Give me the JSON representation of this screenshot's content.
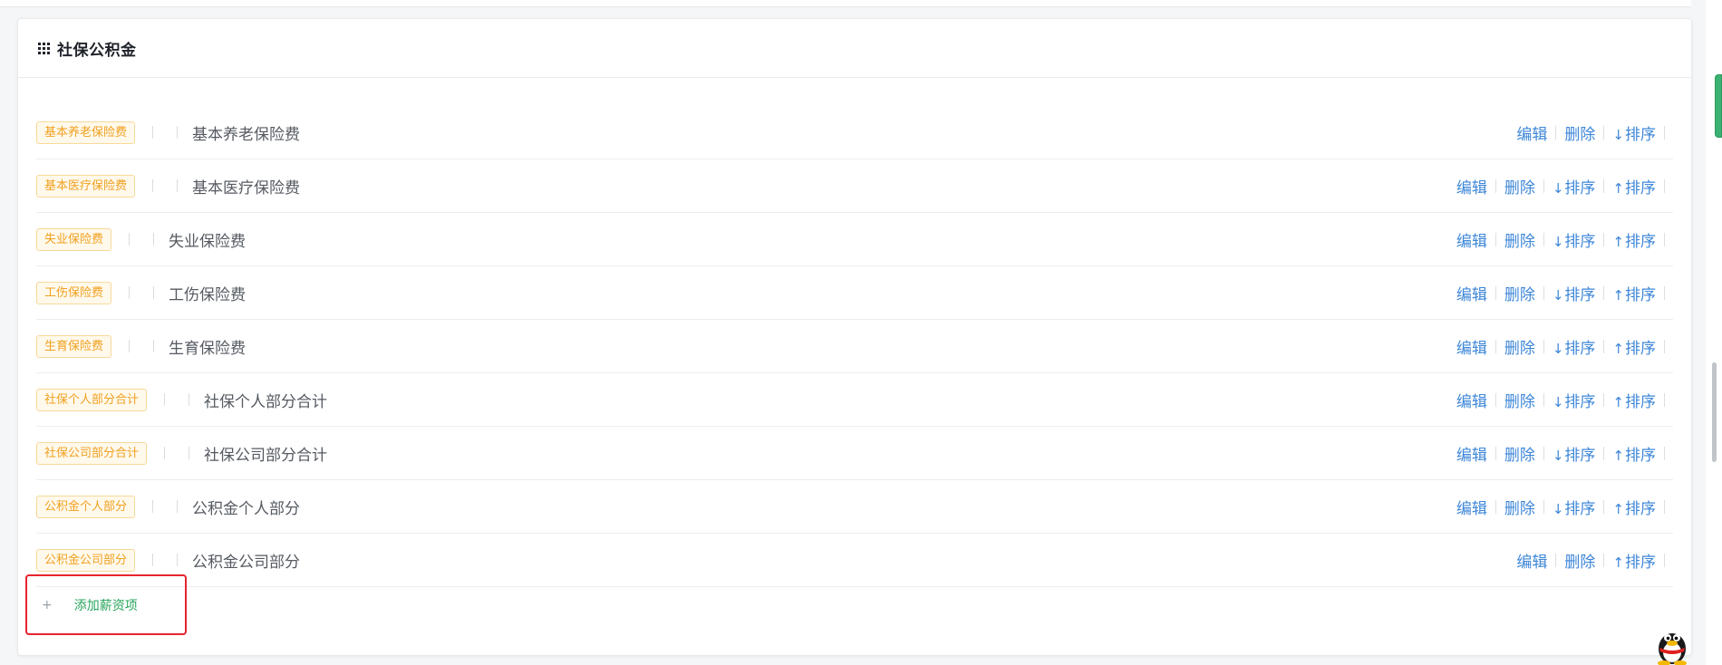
{
  "section": {
    "title": "社保公积金"
  },
  "rows": [
    {
      "tag": "基本养老保险费",
      "name": "基本养老保险费",
      "actions": {
        "edit": "编辑",
        "delete": "删除",
        "sort_down": "排序",
        "sort_up": null
      }
    },
    {
      "tag": "基本医疗保险费",
      "name": "基本医疗保险费",
      "actions": {
        "edit": "编辑",
        "delete": "删除",
        "sort_down": "排序",
        "sort_up": "排序"
      }
    },
    {
      "tag": "失业保险费",
      "name": "失业保险费",
      "actions": {
        "edit": "编辑",
        "delete": "删除",
        "sort_down": "排序",
        "sort_up": "排序"
      }
    },
    {
      "tag": "工伤保险费",
      "name": "工伤保险费",
      "actions": {
        "edit": "编辑",
        "delete": "删除",
        "sort_down": "排序",
        "sort_up": "排序"
      }
    },
    {
      "tag": "生育保险费",
      "name": "生育保险费",
      "actions": {
        "edit": "编辑",
        "delete": "删除",
        "sort_down": "排序",
        "sort_up": "排序"
      }
    },
    {
      "tag": "社保个人部分合计",
      "name": "社保个人部分合计",
      "actions": {
        "edit": "编辑",
        "delete": "删除",
        "sort_down": "排序",
        "sort_up": "排序"
      }
    },
    {
      "tag": "社保公司部分合计",
      "name": "社保公司部分合计",
      "actions": {
        "edit": "编辑",
        "delete": "删除",
        "sort_down": "排序",
        "sort_up": "排序"
      }
    },
    {
      "tag": "公积金个人部分",
      "name": "公积金个人部分",
      "actions": {
        "edit": "编辑",
        "delete": "删除",
        "sort_down": "排序",
        "sort_up": "排序"
      }
    },
    {
      "tag": "公积金公司部分",
      "name": "公积金公司部分",
      "actions": {
        "edit": "编辑",
        "delete": "删除",
        "sort_down": null,
        "sort_up": "排序"
      }
    }
  ],
  "add_button": {
    "label": "添加薪资项",
    "icon": "plus-icon"
  },
  "colors": {
    "tag_text": "#f0a020",
    "tag_border": "#f8d99a",
    "action_link": "#3e87d8",
    "add_text": "#27a55b",
    "highlight_border": "#e8232e"
  }
}
